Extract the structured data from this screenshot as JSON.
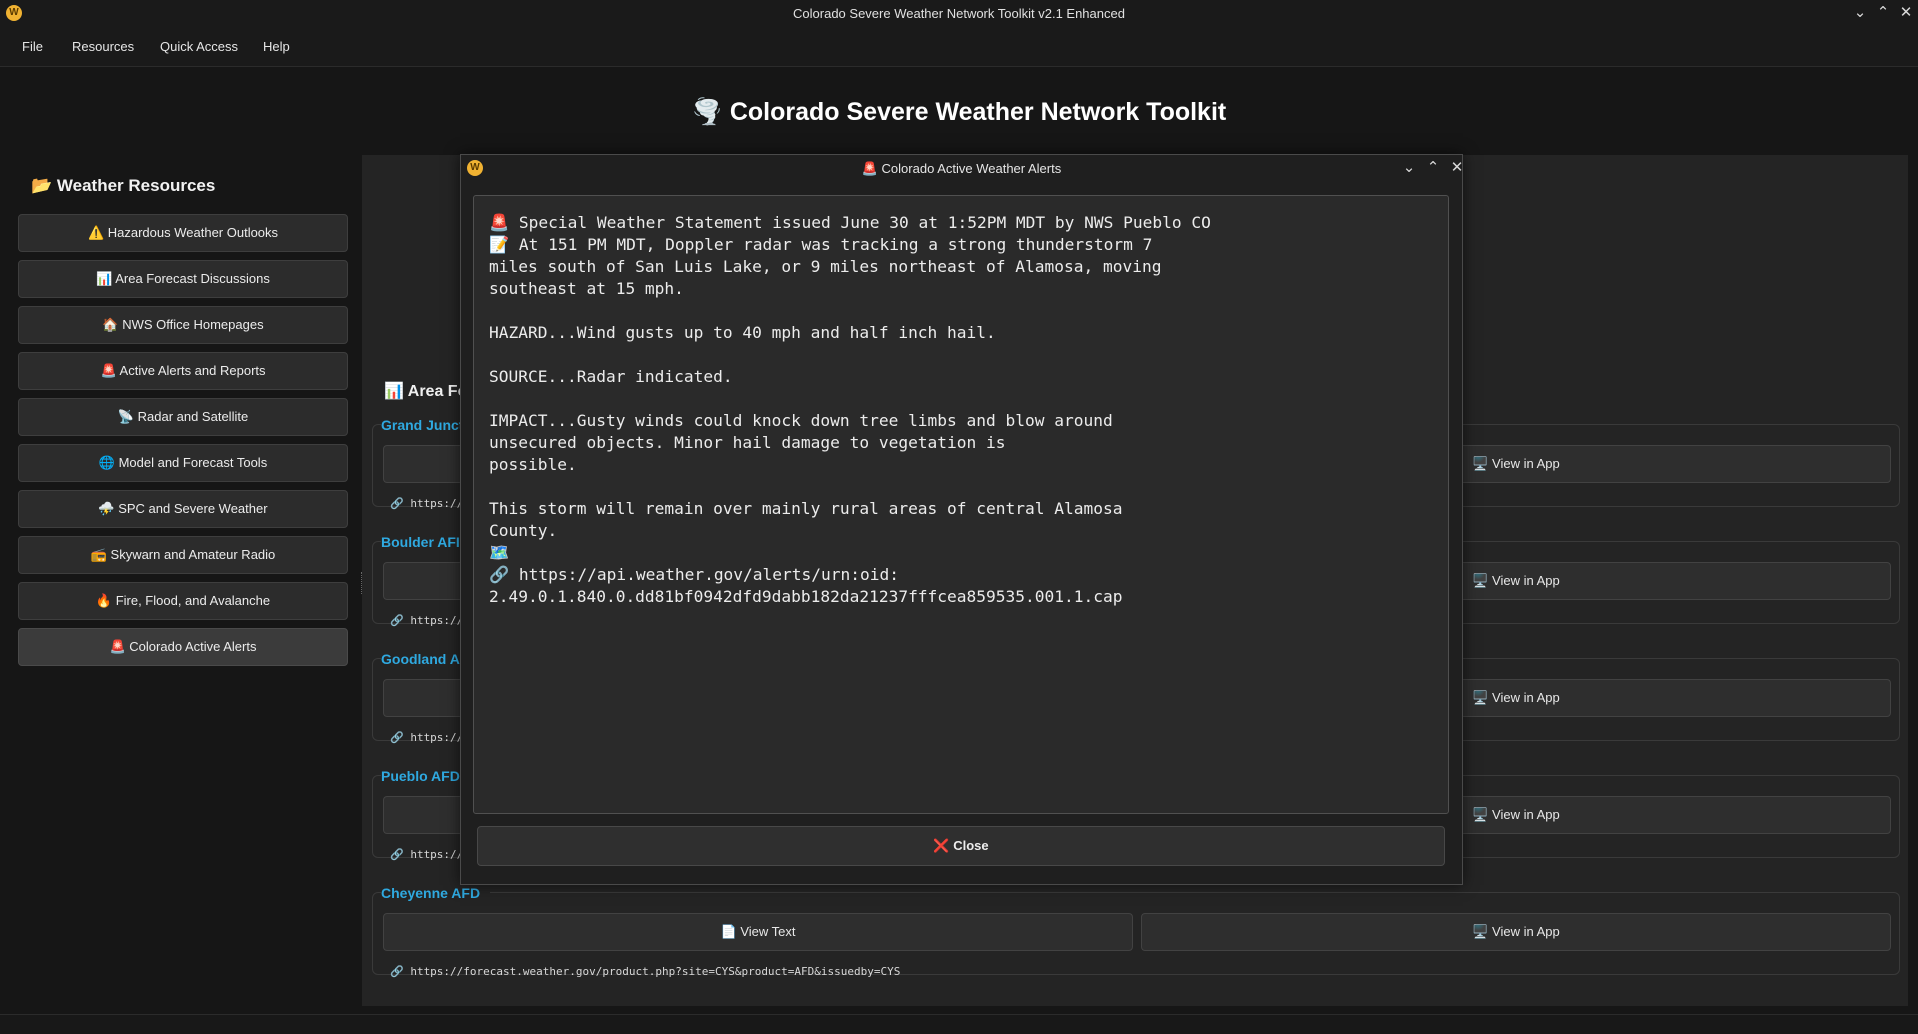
{
  "window": {
    "title": "Colorado Severe Weather Network Toolkit v2.1 Enhanced",
    "logo": "W"
  },
  "menu": [
    "File",
    "Resources",
    "Quick Access",
    "Help"
  ],
  "main_title": "🌪️ Colorado Severe Weather Network Toolkit",
  "sidebar": {
    "heading": "📂 Weather Resources",
    "items": [
      "⚠️ Hazardous Weather Outlooks",
      "📊 Area Forecast Discussions",
      "🏠 NWS Office Homepages",
      "🚨 Active Alerts and Reports",
      "📡 Radar and Satellite",
      "🌐 Model and Forecast Tools",
      "⛈️ SPC and Severe Weather",
      "📻 Skywarn and Amateur Radio",
      "🔥 Fire, Flood, and Avalanche",
      "🚨 Colorado Active Alerts"
    ]
  },
  "section_heading": "📊 Area Fo",
  "groups": [
    {
      "title": "Grand Junct",
      "url": "🔗 https://",
      "view_app": "🖥️ View in App"
    },
    {
      "title": "Boulder AFI",
      "url": "🔗 https://",
      "view_app": "🖥️ View in App"
    },
    {
      "title": "Goodland A",
      "url": "🔗 https://",
      "view_app": "🖥️ View in App"
    },
    {
      "title": "Pueblo AFD",
      "url": "🔗 https://",
      "view_app": "🖥️ View in App"
    },
    {
      "title": "Cheyenne AFD",
      "url": "🔗 https://forecast.weather.gov/product.php?site=CYS&product=AFD&issuedby=CYS",
      "view_text": "📄 View Text",
      "view_app": "🖥️ View in App"
    }
  ],
  "dialog": {
    "title": "🚨 Colorado Active Weather Alerts",
    "logo": "W",
    "alert_text": "🚨 Special Weather Statement issued June 30 at 1:52PM MDT by NWS Pueblo CO\n📝 At 151 PM MDT, Doppler radar was tracking a strong thunderstorm 7\nmiles south of San Luis Lake, or 9 miles northeast of Alamosa, moving\nsoutheast at 15 mph.\n\nHAZARD...Wind gusts up to 40 mph and half inch hail.\n\nSOURCE...Radar indicated.\n\nIMPACT...Gusty winds could knock down tree limbs and blow around\nunsecured objects. Minor hail damage to vegetation is\npossible.\n\nThis storm will remain over mainly rural areas of central Alamosa\nCounty.\n🗺️\n🔗 https://api.weather.gov/alerts/urn:oid:\n2.49.0.1.840.0.dd81bf0942dfd9dabb182da21237fffcea859535.001.1.cap",
    "close_label": "Close"
  }
}
